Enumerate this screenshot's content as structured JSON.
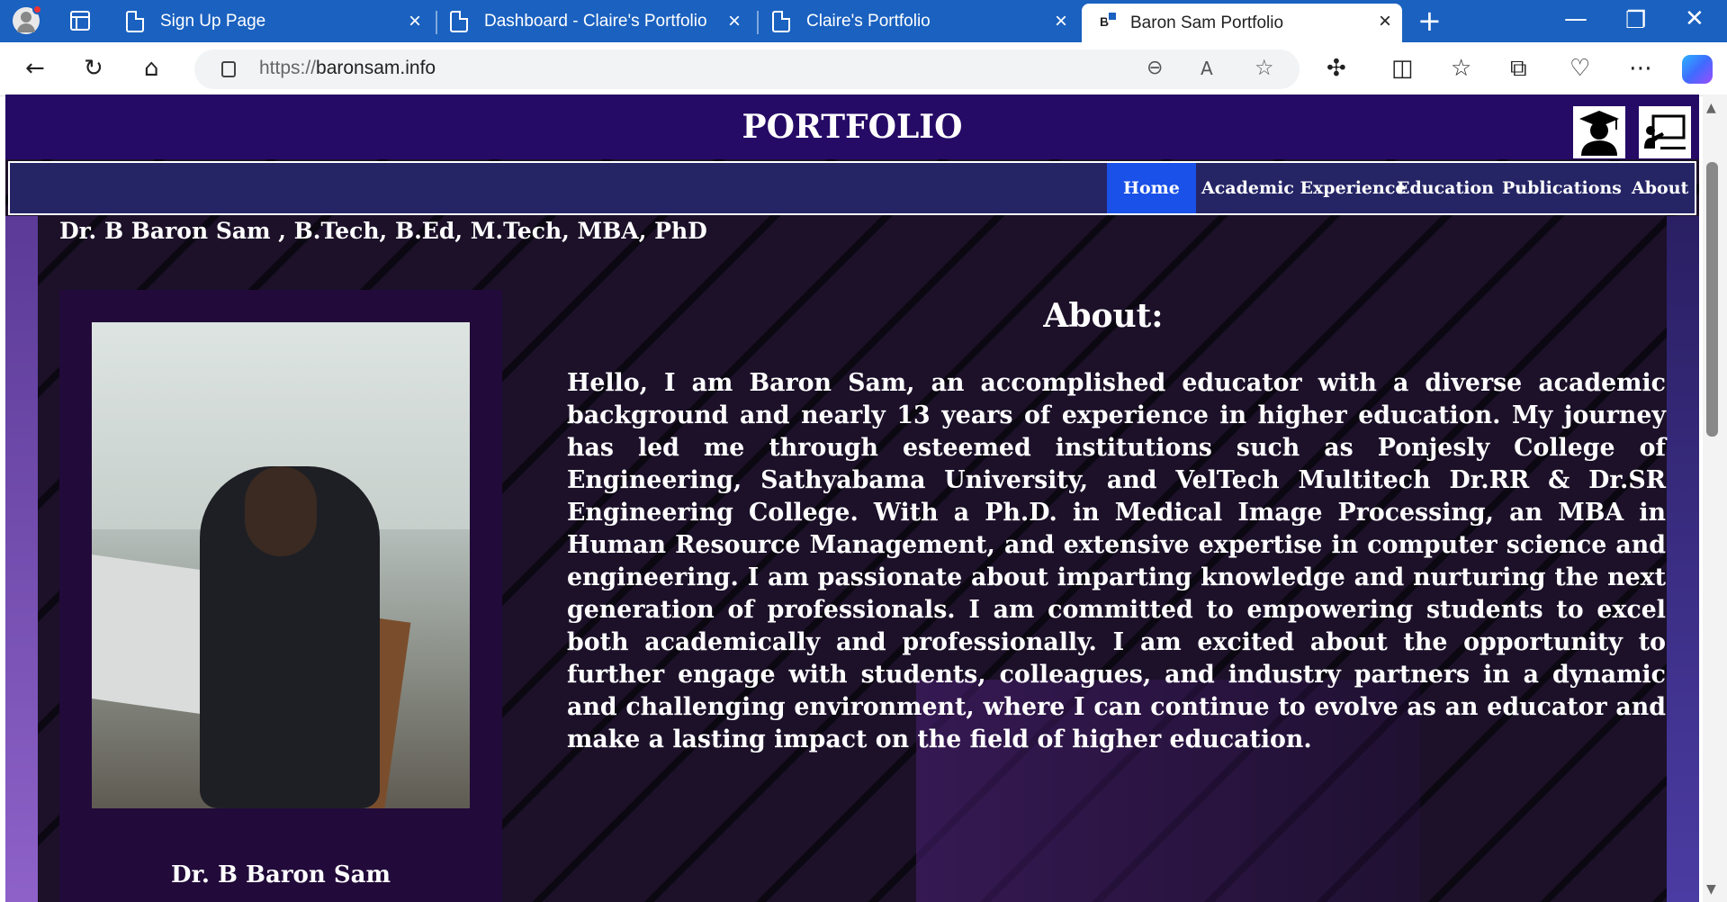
{
  "browser": {
    "tabs": [
      {
        "label": "Sign Up Page"
      },
      {
        "label": "Dashboard - Claire's Portfolio"
      },
      {
        "label": "Claire's Portfolio"
      },
      {
        "label": "Baron Sam Portfolio",
        "favicon": "B"
      }
    ],
    "url_scheme": "https://",
    "url_host": "baronsam.info"
  },
  "site": {
    "title": "PORTFOLIO",
    "nav": [
      {
        "label": "Home",
        "active": true
      },
      {
        "label": "Academic Experience"
      },
      {
        "label": "Education"
      },
      {
        "label": "Publications"
      },
      {
        "label": "About"
      }
    ],
    "name_heading": "Dr. B Baron Sam , B.Tech, B.Ed, M.Tech, MBA, PhD",
    "card_name": "Dr.  B Baron Sam",
    "about_heading": "About:",
    "about_text": "Hello, I am Baron Sam, an accomplished educator with a diverse academic background and nearly 13 years of experience in higher education. My journey has led me through esteemed institutions such as Ponjesly College of Engineering, Sathyabama University, and VelTech Multitech Dr.RR & Dr.SR Engineering College. With a Ph.D. in Medical Image Processing, an MBA in Human Resource Management, and extensive expertise in computer science and engineering. I am passionate about imparting knowledge and nurturing the next generation of professionals. I am committed to empowering students to excel both academically and professionally. I am excited about the opportunity to further engage with students, colleagues, and industry partners in a dynamic and challenging environment, where I can continue to evolve as an educator and make a lasting impact on the field of higher education."
  },
  "colors": {
    "tab_bar": "#1a61c0",
    "header_bg": "#250a66",
    "nav_bg": "#252566",
    "nav_active": "#1a51e8",
    "card_bg": "#220a3a"
  }
}
